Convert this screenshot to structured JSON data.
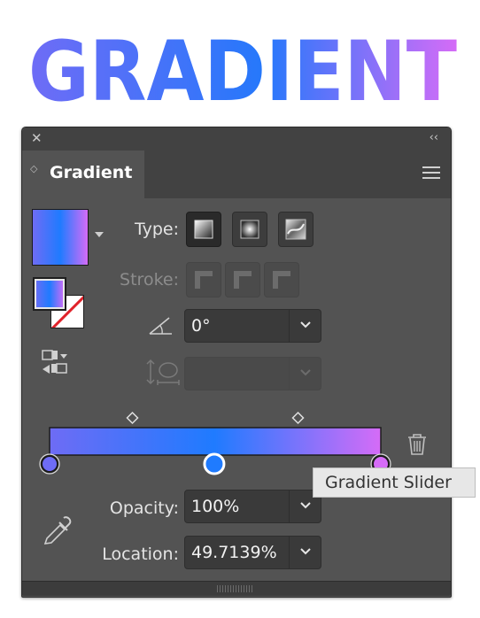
{
  "headline": {
    "text": "GRADIENT"
  },
  "panel": {
    "tab_title": "Gradient",
    "type_label": "Type:",
    "stroke_label": "Stroke:",
    "angle_value": "0°",
    "opacity_label": "Opacity:",
    "opacity_value": "100%",
    "location_label": "Location:",
    "location_value": "49.7139%",
    "type_buttons": [
      "linear-gradient-icon",
      "radial-gradient-icon",
      "freeform-gradient-icon"
    ],
    "stroke_buttons": [
      "stroke-within-icon",
      "stroke-along-icon",
      "stroke-across-icon"
    ]
  },
  "slider": {
    "stops": [
      {
        "location": 0,
        "color": "#6e6cf5"
      },
      {
        "location": 49.7139,
        "color": "#1f7bff",
        "selected": true
      },
      {
        "location": 100,
        "color": "#d56cf7"
      }
    ],
    "midpoints": [
      25,
      75
    ]
  },
  "tooltip": {
    "text": "Gradient Slider"
  },
  "colors": {
    "panel_bg": "#535353",
    "gradient_start": "#6e6cf5",
    "gradient_mid": "#1f7bff",
    "gradient_end": "#d56cf7"
  }
}
